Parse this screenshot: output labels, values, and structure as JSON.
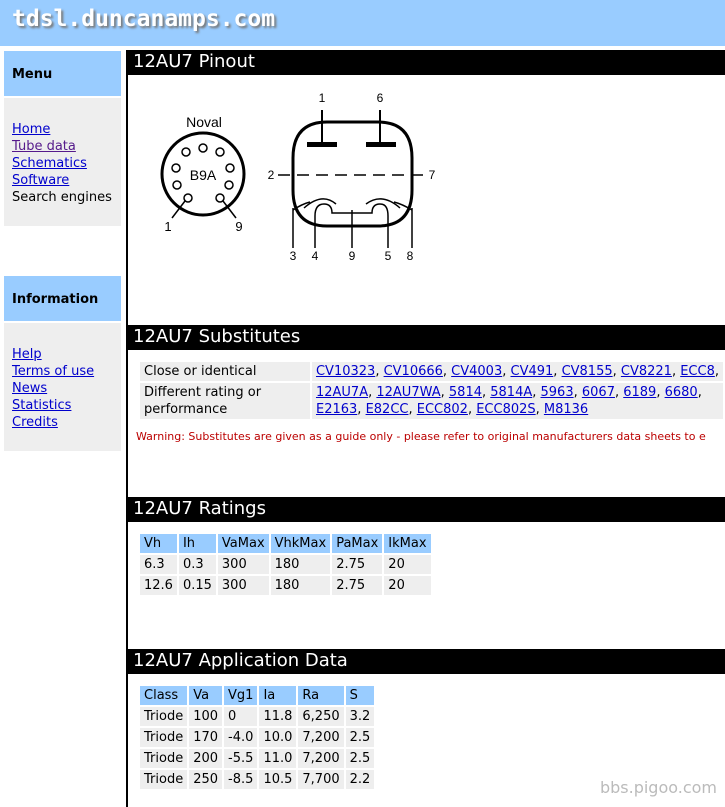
{
  "site_title": "tdsl.duncanamps.com",
  "sidebar": {
    "menu_title": "Menu",
    "menu_items": [
      {
        "label": "Home"
      },
      {
        "label": "Tube data"
      },
      {
        "label": "Schematics"
      },
      {
        "label": "Software"
      },
      {
        "label": "Search engines"
      }
    ],
    "info_title": "Information",
    "info_items": [
      {
        "label": "Help"
      },
      {
        "label": "Terms of use"
      },
      {
        "label": "News"
      },
      {
        "label": "Statistics"
      },
      {
        "label": "Credits"
      }
    ]
  },
  "pinout": {
    "title": "12AU7 Pinout",
    "base_name": "Noval",
    "base_code": "B9A",
    "base_pins": [
      "1",
      "9"
    ],
    "pins": [
      "1",
      "6",
      "2",
      "7",
      "3",
      "4",
      "9",
      "5",
      "8"
    ]
  },
  "substitutes": {
    "title": "12AU7 Substitutes",
    "rows": [
      {
        "label": "Close or identical",
        "items": [
          "CV10323",
          "CV10666",
          "CV4003",
          "CV491",
          "CV8155",
          "CV8221",
          "ECC8"
        ]
      },
      {
        "label": "Different rating or performance",
        "items": [
          "12AU7A",
          "12AU7WA",
          "5814",
          "5814A",
          "5963",
          "6067",
          "6189",
          "6680"
        ],
        "items2": [
          "E2163",
          "E82CC",
          "ECC802",
          "ECC802S",
          "M8136"
        ]
      }
    ],
    "warning": "Warning: Substitutes are given as a guide only - please refer to original manufacturers data sheets to e"
  },
  "ratings": {
    "title": "12AU7 Ratings",
    "headers": [
      "Vh",
      "Ih",
      "VaMax",
      "VhkMax",
      "PaMax",
      "IkMax"
    ],
    "rows": [
      [
        "6.3",
        "0.3",
        "300",
        "180",
        "2.75",
        "20"
      ],
      [
        "12.6",
        "0.15",
        "300",
        "180",
        "2.75",
        "20"
      ]
    ]
  },
  "application": {
    "title": "12AU7 Application Data",
    "headers": [
      "Class",
      "Va",
      "Vg1",
      "Ia",
      "Ra",
      "S"
    ],
    "rows": [
      [
        "Triode",
        "100",
        "0",
        "11.8",
        "6,250",
        "3.2"
      ],
      [
        "Triode",
        "170",
        "-4.0",
        "10.0",
        "7,200",
        "2.5"
      ],
      [
        "Triode",
        "200",
        "-5.5",
        "11.0",
        "7,200",
        "2.5"
      ],
      [
        "Triode",
        "250",
        "-8.5",
        "10.5",
        "7,700",
        "2.2"
      ]
    ]
  },
  "watermark": "bbs.pigoo.com"
}
